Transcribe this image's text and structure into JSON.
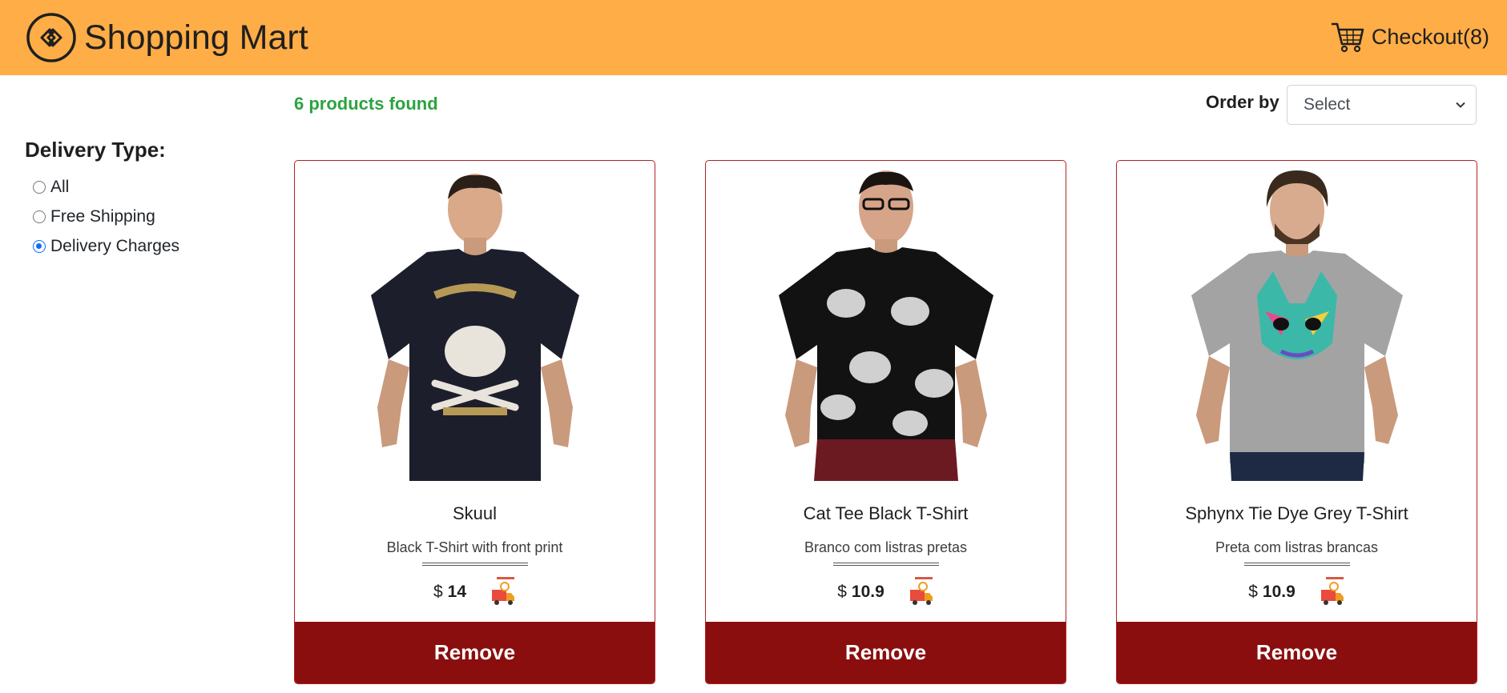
{
  "header": {
    "brand_title": "Shopping Mart",
    "checkout_label": "Checkout(8)",
    "bg_color": "#ffad46"
  },
  "results": {
    "count_text": "6 products found",
    "order_label": "Order by",
    "order_selected": "Select"
  },
  "sidebar": {
    "title": "Delivery Type:",
    "options": [
      {
        "label": "All",
        "checked": false
      },
      {
        "label": "Free Shipping",
        "checked": false
      },
      {
        "label": "Delivery Charges",
        "checked": true
      }
    ]
  },
  "products": [
    {
      "name": "Skuul",
      "description": "Black T-Shirt with front print",
      "currency": "$",
      "price": "14",
      "remove_label": "Remove",
      "shirt_color": "#1c1e2c",
      "icon": "delivery-truck-icon"
    },
    {
      "name": "Cat Tee Black T-Shirt",
      "description": "Branco com listras pretas",
      "currency": "$",
      "price": "10.9",
      "remove_label": "Remove",
      "shirt_color": "#121212",
      "icon": "delivery-truck-icon"
    },
    {
      "name": "Sphynx Tie Dye Grey T-Shirt",
      "description": "Preta com listras brancas",
      "currency": "$",
      "price": "10.9",
      "remove_label": "Remove",
      "shirt_color": "#a3a3a3",
      "icon": "delivery-truck-icon"
    }
  ],
  "colors": {
    "accent_green": "#2ca33f",
    "remove_bg": "#8b0e0e",
    "card_border": "#b22222"
  }
}
